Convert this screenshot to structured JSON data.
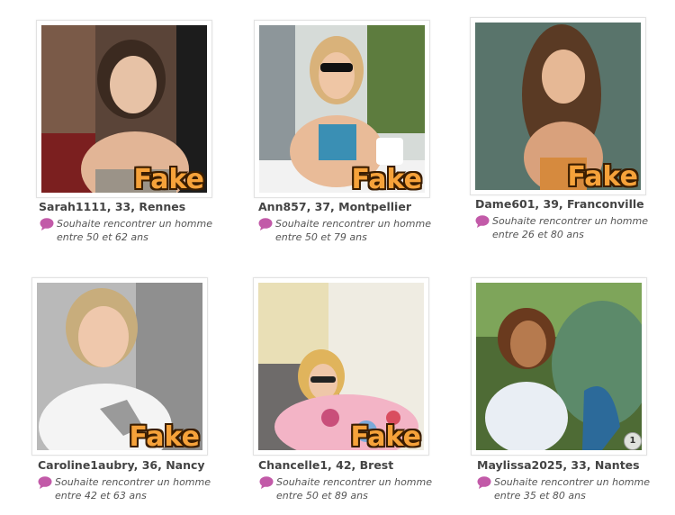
{
  "badge": {
    "fake_label": "Fake"
  },
  "profiles": [
    {
      "name_line": "Sarah1111, 33, Rennes",
      "wish_line1": "Souhaite rencontrer un homme",
      "wish_line2": "entre 50 et 62 ans",
      "fake": true
    },
    {
      "name_line": "Ann857, 37, Montpellier",
      "wish_line1": "Souhaite rencontrer un homme",
      "wish_line2": "entre 50 et 79 ans",
      "fake": true
    },
    {
      "name_line": "Dame601, 39, Franconville",
      "wish_line1": "Souhaite rencontrer un homme",
      "wish_line2": "entre 26 et 80 ans",
      "fake": true
    },
    {
      "name_line": "Caroline1aubry, 36, Nancy",
      "wish_line1": "Souhaite rencontrer un homme",
      "wish_line2": "entre 42 et 63 ans",
      "fake": true
    },
    {
      "name_line": "Chancelle1, 42, Brest",
      "wish_line1": "Souhaite rencontrer un homme",
      "wish_line2": "entre 50 et 89 ans",
      "fake": true
    },
    {
      "name_line": "Maylissa2025, 33, Nantes",
      "wish_line1": "Souhaite rencontrer un homme",
      "wish_line2": "entre 35 et 80 ans",
      "fake": false,
      "photo_count": "1"
    }
  ],
  "colors": {
    "fake_fill": "#f6a23a",
    "fake_outline": "#3a1d00",
    "bubble": "#c25aa8"
  }
}
